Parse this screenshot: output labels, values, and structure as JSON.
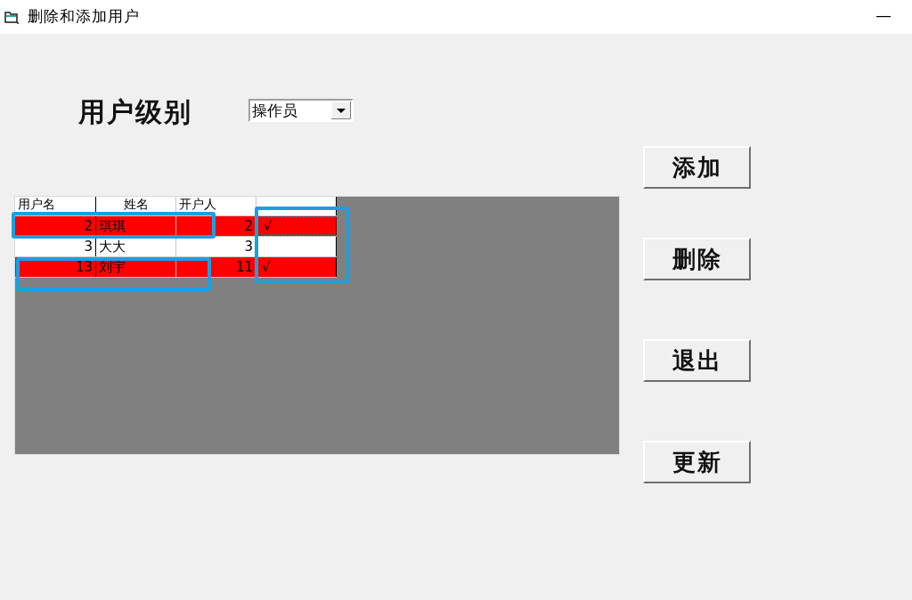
{
  "window": {
    "title": "删除和添加用户"
  },
  "user_level": {
    "label": "用户级别",
    "dropdown": {
      "value": "操作员"
    }
  },
  "grid": {
    "columns": [
      "用户名",
      "姓名",
      "开户人"
    ],
    "rows": [
      {
        "cells": [
          "2",
          "琪琪",
          "2",
          "√"
        ],
        "marked": true,
        "focused": true
      },
      {
        "cells": [
          "3",
          "大大",
          "3"
        ],
        "marked": false,
        "focused": false
      },
      {
        "cells": [
          "13",
          "刘宇",
          "11",
          "√"
        ],
        "marked": true,
        "focused": false
      }
    ]
  },
  "buttons": [
    "添加",
    "删除",
    "退出",
    "更新"
  ]
}
